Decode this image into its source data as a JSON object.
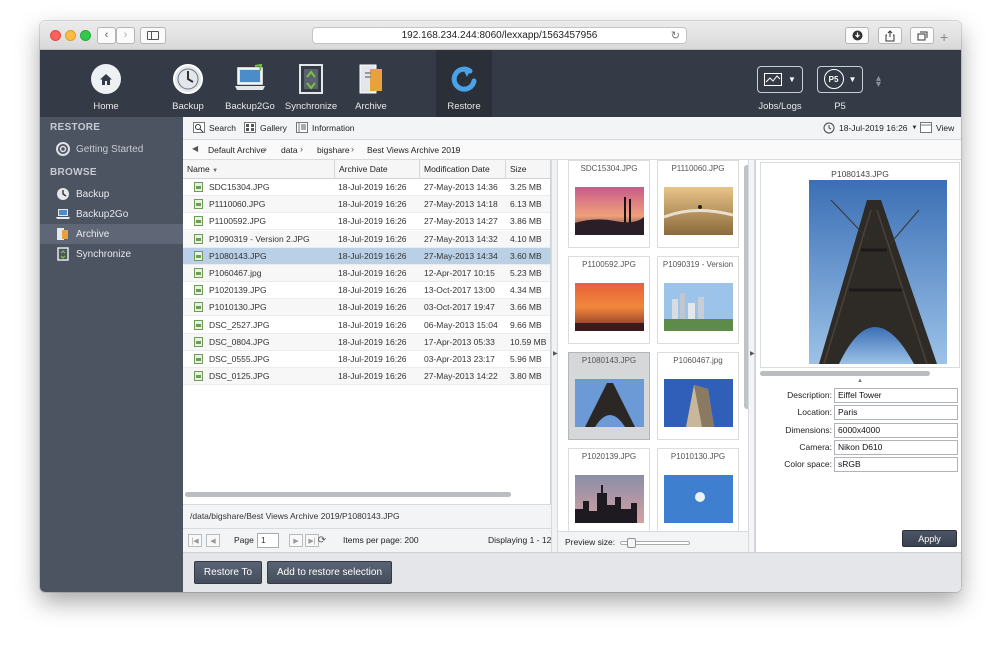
{
  "browser": {
    "url": "192.168.234.244:8060/lexxapp/1563457956"
  },
  "toolbar": {
    "items": [
      {
        "label": "Home",
        "icon": "home-icon"
      },
      {
        "label": "Backup",
        "icon": "backup-icon"
      },
      {
        "label": "Backup2Go",
        "icon": "backup2go-icon"
      },
      {
        "label": "Synchronize",
        "icon": "synchronize-icon"
      },
      {
        "label": "Archive",
        "icon": "archive-icon"
      },
      {
        "label": "Restore",
        "icon": "restore-icon"
      }
    ],
    "jobs_label": "Jobs/Logs",
    "p5_label": "P5",
    "p5_badge": "P5",
    "active": "Restore"
  },
  "sidebar": {
    "restore_heading": "RESTORE",
    "browse_heading": "BROWSE",
    "restore_items": [
      {
        "label": "Getting Started"
      }
    ],
    "browse_items": [
      {
        "label": "Backup"
      },
      {
        "label": "Backup2Go"
      },
      {
        "label": "Archive"
      },
      {
        "label": "Synchronize"
      }
    ],
    "selected": "Archive"
  },
  "subtoolbar": {
    "search": "Search",
    "gallery": "Gallery",
    "information": "Information",
    "date": "18-Jul-2019 16:26",
    "view": "View"
  },
  "breadcrumb": [
    "Default Archive",
    "data",
    "bigshare",
    "Best Views Archive 2019"
  ],
  "table": {
    "columns": [
      "Name",
      "Archive Date",
      "Modification Date",
      "Size"
    ],
    "rows": [
      {
        "name": "SDC15304.JPG",
        "archive": "18-Jul-2019 16:26",
        "modified": "27-May-2013 14:36",
        "size": "3.25 MB"
      },
      {
        "name": "P1110060.JPG",
        "archive": "18-Jul-2019 16:26",
        "modified": "27-May-2013 14:18",
        "size": "6.13 MB"
      },
      {
        "name": "P1100592.JPG",
        "archive": "18-Jul-2019 16:26",
        "modified": "27-May-2013 14:27",
        "size": "3.86 MB"
      },
      {
        "name": "P1090319 - Version 2.JPG",
        "archive": "18-Jul-2019 16:26",
        "modified": "27-May-2013 14:32",
        "size": "4.10 MB"
      },
      {
        "name": "P1080143.JPG",
        "archive": "18-Jul-2019 16:26",
        "modified": "27-May-2013 14:34",
        "size": "3.60 MB"
      },
      {
        "name": "P1060467.jpg",
        "archive": "18-Jul-2019 16:26",
        "modified": "12-Apr-2017 10:15",
        "size": "5.23 MB"
      },
      {
        "name": "P1020139.JPG",
        "archive": "18-Jul-2019 16:26",
        "modified": "13-Oct-2017 13:00",
        "size": "4.34 MB"
      },
      {
        "name": "P1010130.JPG",
        "archive": "18-Jul-2019 16:26",
        "modified": "03-Oct-2017 19:47",
        "size": "3.66 MB"
      },
      {
        "name": "DSC_2527.JPG",
        "archive": "18-Jul-2019 16:26",
        "modified": "06-May-2013 15:04",
        "size": "9.66 MB"
      },
      {
        "name": "DSC_0804.JPG",
        "archive": "18-Jul-2019 16:26",
        "modified": "17-Apr-2013 05:33",
        "size": "10.59 MB"
      },
      {
        "name": "DSC_0555.JPG",
        "archive": "18-Jul-2019 16:26",
        "modified": "03-Apr-2013 23:17",
        "size": "5.96 MB"
      },
      {
        "name": "DSC_0125.JPG",
        "archive": "18-Jul-2019 16:26",
        "modified": "27-May-2013 14:22",
        "size": "3.80 MB"
      }
    ],
    "selected_index": 4
  },
  "path": "/data/bigshare/Best Views Archive 2019/P1080143.JPG",
  "pager": {
    "page_label": "Page",
    "page_value": "1",
    "items_per_page": "Items per page: 200",
    "displaying": "Displaying 1 - 12"
  },
  "thumbnails": [
    {
      "label": "SDC15304.JPG",
      "theme": "sunset"
    },
    {
      "label": "P1110060.JPG",
      "theme": "surf"
    },
    {
      "label": "P1100592.JPG",
      "theme": "red-sky"
    },
    {
      "label": "P1090319 - Version",
      "theme": "city"
    },
    {
      "label": "P1080143.JPG",
      "theme": "tower"
    },
    {
      "label": "P1060467.jpg",
      "theme": "flatiron"
    },
    {
      "label": "P1020139.JPG",
      "theme": "skyline"
    },
    {
      "label": "P1010130.JPG",
      "theme": "moon"
    }
  ],
  "selected_thumbnail": 4,
  "preview_size_label": "Preview size:",
  "preview": {
    "title": "P1080143.JPG",
    "metadata": [
      {
        "label": "Description:",
        "value": "Eiffel Tower"
      },
      {
        "label": "Location:",
        "value": "Paris"
      },
      {
        "label": "Dimensions:",
        "value": "6000x4000"
      },
      {
        "label": "Camera:",
        "value": "Nikon D610"
      },
      {
        "label": "Color space:",
        "value": "sRGB"
      }
    ],
    "apply_label": "Apply"
  },
  "actions": {
    "restore_to": "Restore To",
    "add_to_selection": "Add to restore selection"
  },
  "colors": {
    "toolbar": "#343b47",
    "sidebar": "#4c5361",
    "selected_row": "#b9d0e6",
    "restore_accent": "#3d8fd8"
  }
}
